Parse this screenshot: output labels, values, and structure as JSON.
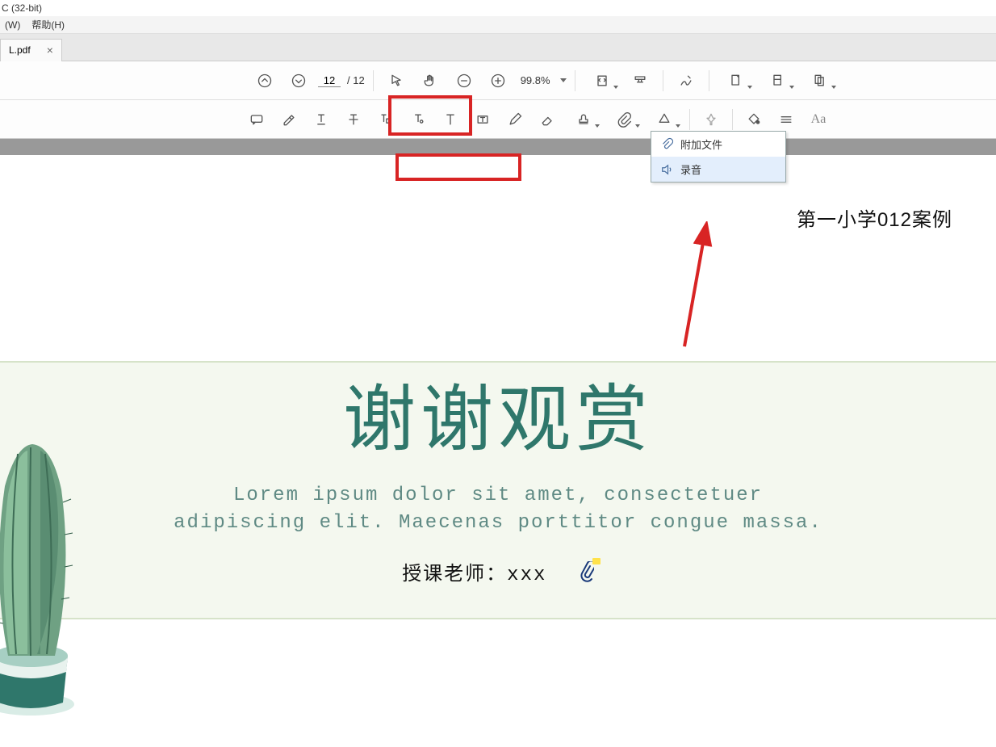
{
  "titlebar": {
    "text": "C (32-bit)"
  },
  "menubar": {
    "window": "(W)",
    "help": "帮助(H)"
  },
  "tab": {
    "label": "L.pdf",
    "close": "×"
  },
  "toolbar": {
    "page_current": "12",
    "page_total": "/ 12",
    "zoom": "99.8%"
  },
  "dropdown": {
    "attach_file": "附加文件",
    "record_audio": "录音"
  },
  "document": {
    "header_right": "第一小学012案例",
    "slide_title": "谢谢观赏",
    "slide_sub_line1": "Lorem ipsum dolor sit amet, consectetuer",
    "slide_sub_line2": "adipiscing elit. Maecenas porttitor congue massa.",
    "teacher_label": "授课老师：xxx"
  }
}
